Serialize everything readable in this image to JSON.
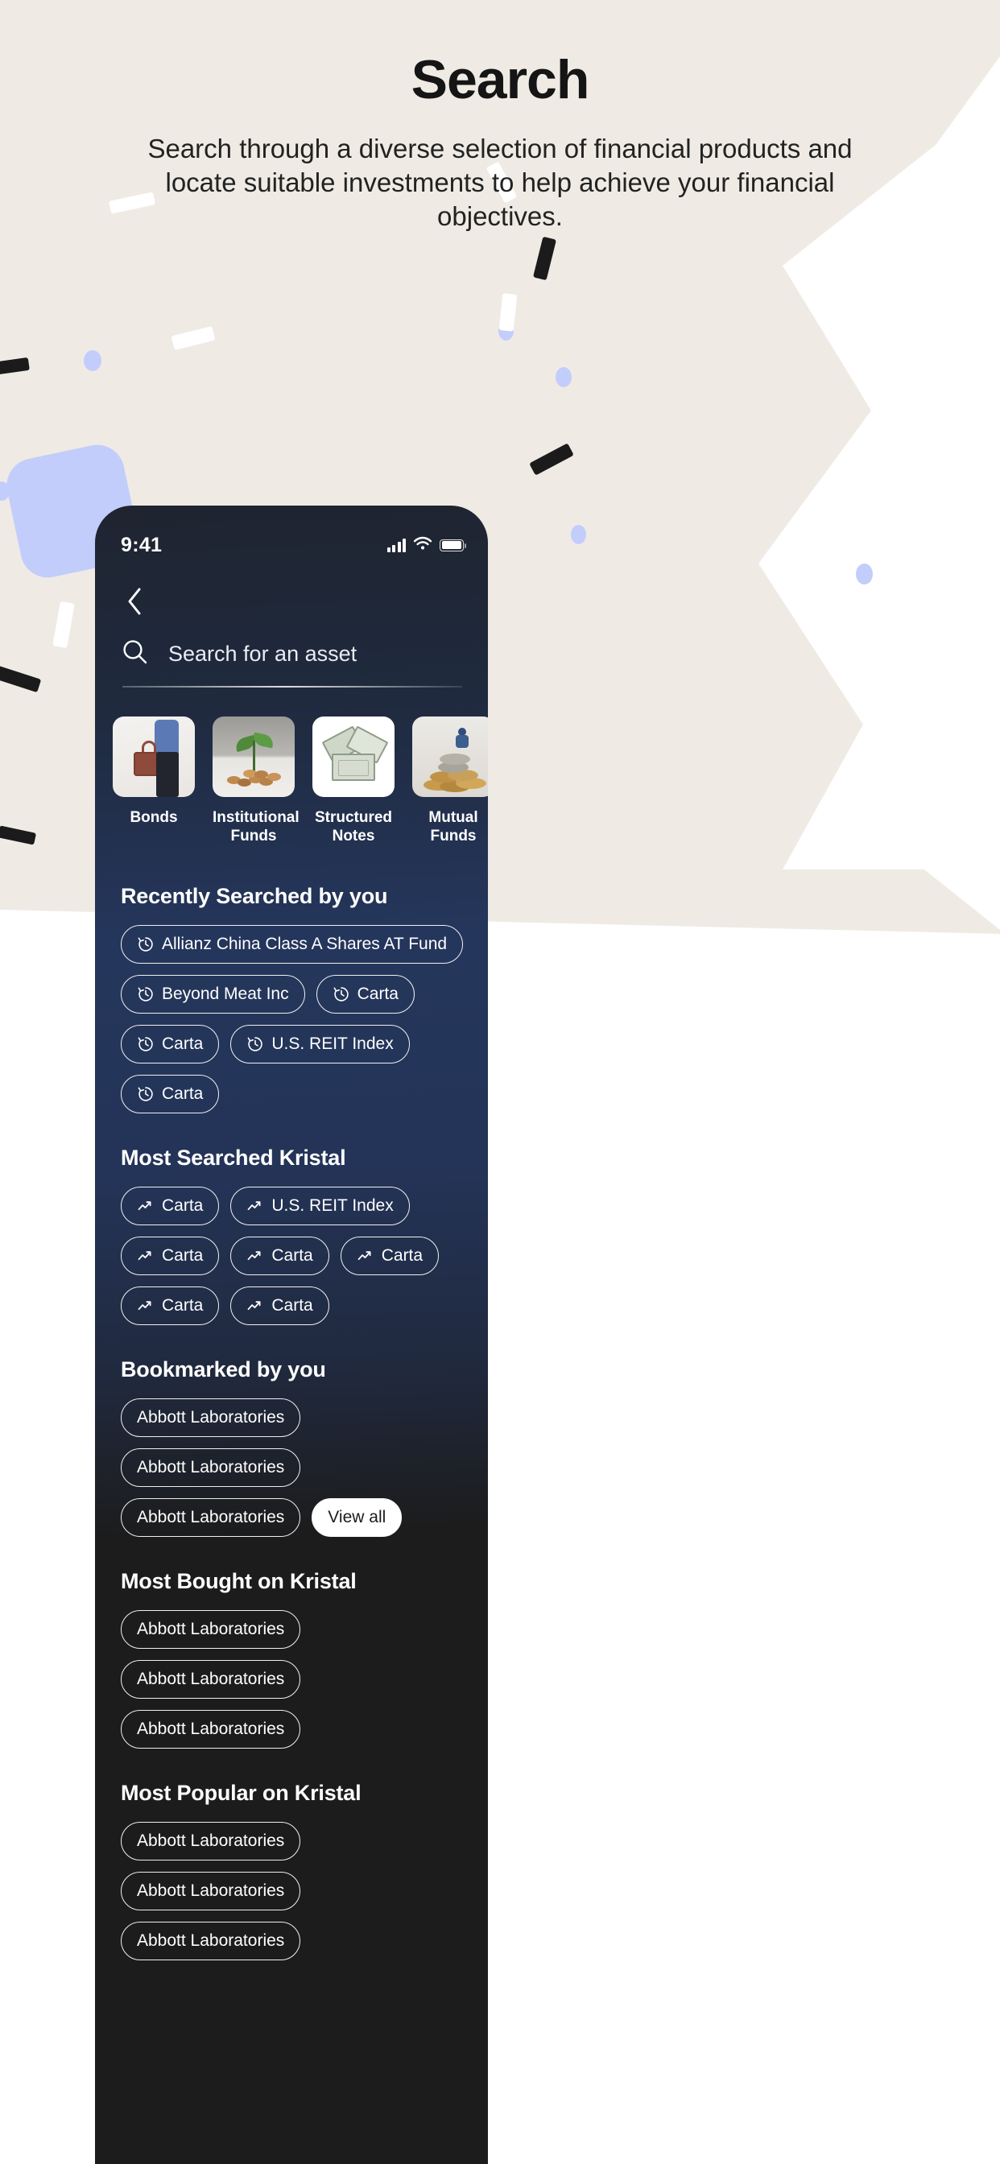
{
  "hero": {
    "title": "Search",
    "subtitle": "Search through a diverse selection of financial products and locate suitable investments to help achieve your financial objectives."
  },
  "colors": {
    "page_background": "#ffffff",
    "beige_panel": "#efebe4",
    "accent_blue_shape": "#c3cdfb",
    "phone_screen_top": "#25365c",
    "phone_screen_bottom": "#1c1c1c",
    "chip_border": "#f0f0f0",
    "chip_filled_bg": "#ffffff"
  },
  "phone": {
    "status_bar": {
      "time": "9:41",
      "signal_icon": "cellular-signal-icon",
      "wifi_icon": "wifi-icon",
      "battery_icon": "battery-icon"
    },
    "nav": {
      "back_icon": "chevron-left-icon"
    },
    "search": {
      "icon": "search-icon",
      "placeholder": "Search for an asset",
      "value": ""
    },
    "categories": [
      {
        "label": "Bonds",
        "image": "briefcase-photo"
      },
      {
        "label": "Institutional Funds",
        "image": "plant-coins-photo"
      },
      {
        "label": "Structured Notes",
        "image": "dollar-house-photo"
      },
      {
        "label": "Mutual Funds",
        "image": "coin-stack-photo"
      }
    ],
    "sections": [
      {
        "title": "Recently Searched by you",
        "chip_icon": "history-clock-icon",
        "chips": [
          {
            "label": "Allianz China Class A Shares AT Fund",
            "style": "outline"
          },
          {
            "label": "Beyond Meat Inc",
            "style": "outline"
          },
          {
            "label": "Carta",
            "style": "outline"
          },
          {
            "label": "Carta",
            "style": "outline"
          },
          {
            "label": "U.S. REIT Index",
            "style": "outline"
          },
          {
            "label": "Carta",
            "style": "outline"
          }
        ]
      },
      {
        "title": "Most Searched Kristal",
        "chip_icon": "trending-up-icon",
        "chips": [
          {
            "label": "Carta",
            "style": "outline"
          },
          {
            "label": "U.S. REIT Index",
            "style": "outline"
          },
          {
            "label": "Carta",
            "style": "outline"
          },
          {
            "label": "Carta",
            "style": "outline"
          },
          {
            "label": "Carta",
            "style": "outline"
          },
          {
            "label": "Carta",
            "style": "outline"
          },
          {
            "label": "Carta",
            "style": "outline"
          }
        ]
      },
      {
        "title": "Bookmarked by you",
        "chip_icon": "none",
        "chips": [
          {
            "label": "Abbott Laboratories",
            "style": "outline"
          },
          {
            "label": "Abbott Laboratories",
            "style": "outline"
          },
          {
            "label": "Abbott Laboratories",
            "style": "outline"
          },
          {
            "label": "View all",
            "style": "filled"
          }
        ]
      },
      {
        "title": "Most Bought on Kristal",
        "chip_icon": "none",
        "chips": [
          {
            "label": "Abbott Laboratories",
            "style": "outline"
          },
          {
            "label": "Abbott Laboratories",
            "style": "outline"
          },
          {
            "label": "Abbott Laboratories",
            "style": "outline"
          }
        ]
      },
      {
        "title": "Most Popular on Kristal",
        "chip_icon": "none",
        "chips": [
          {
            "label": "Abbott Laboratories",
            "style": "outline"
          },
          {
            "label": "Abbott Laboratories",
            "style": "outline"
          },
          {
            "label": "Abbott Laboratories",
            "style": "outline"
          }
        ]
      }
    ]
  }
}
